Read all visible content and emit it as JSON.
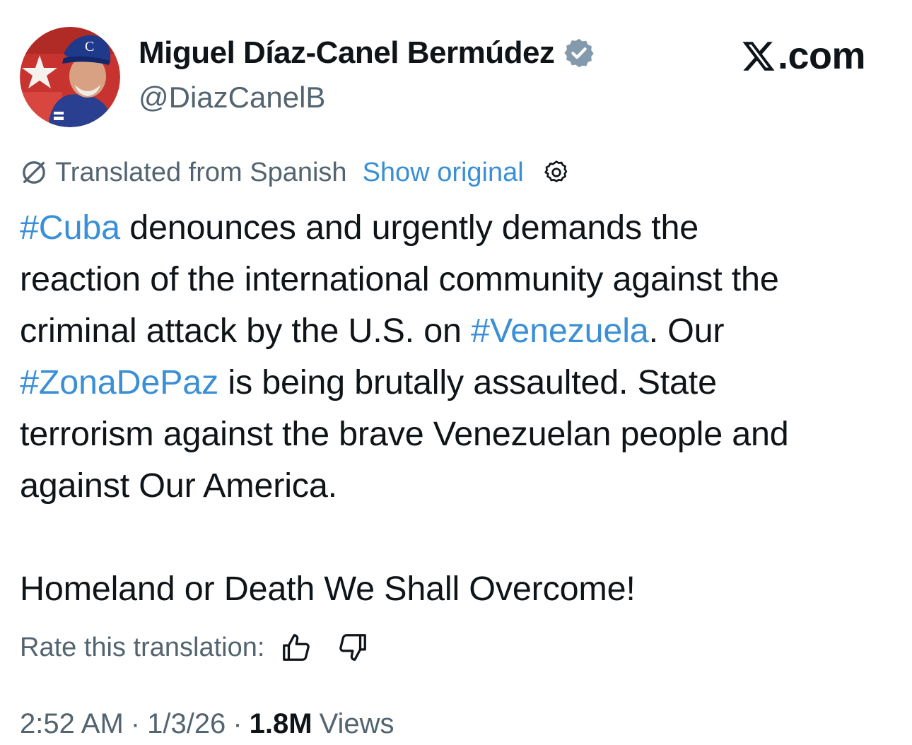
{
  "author": {
    "display_name": "Miguel Díaz-Canel Bermúdez",
    "handle": "@DiazCanelB",
    "verified": true,
    "avatar_cap_letter": "C"
  },
  "brand": {
    "label": ".com"
  },
  "translation": {
    "from_label": "Translated from Spanish",
    "show_original_label": "Show original"
  },
  "tweet": {
    "line1": {
      "tag": "#Cuba",
      "rest": " denounces and urgently demands the"
    },
    "line2": "reaction of the international community against the",
    "line3": {
      "before": "criminal attack by the U.S. on ",
      "tag": "#Venezuela",
      "after": ". Our"
    },
    "line4": {
      "tag": "#ZonaDePaz",
      "rest": " is being brutally assaulted. State"
    },
    "line5": "terrorism against the brave Venezuelan people and",
    "line6": "against Our America.",
    "line8": "Homeland or Death We Shall Overcome!"
  },
  "rate": {
    "label": "Rate this translation:"
  },
  "meta": {
    "time": "2:52 AM",
    "date": "1/3/26",
    "separator": "·",
    "views_count": "1.8M",
    "views_label": "Views"
  },
  "colors": {
    "link": "#3a8fd6",
    "text": "#0f1419",
    "secondary": "#536471",
    "verified_badge": "#829aab"
  },
  "icons": [
    "verified-badge-icon",
    "x-logo-icon",
    "translate-icon",
    "gear-icon",
    "thumbs-up-icon",
    "thumbs-down-icon"
  ]
}
